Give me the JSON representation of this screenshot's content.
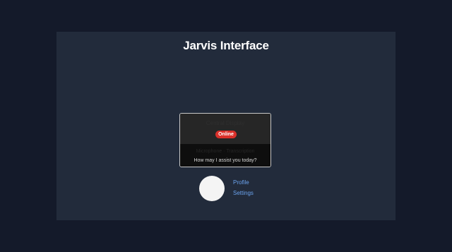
{
  "app": {
    "title": "Jarvis Interface"
  },
  "central_display": {
    "heading": "Central Display",
    "status": "Online",
    "faint_text": "Microphone  ·  Transcription",
    "prompt": "How may I assist you today?"
  },
  "user_menu": {
    "profile_label": "Profile",
    "settings_label": "Settings"
  },
  "colors": {
    "background": "#141a2a",
    "panel": "#222b3b",
    "status_online": "#d9302a",
    "link": "#6aa2ec"
  }
}
